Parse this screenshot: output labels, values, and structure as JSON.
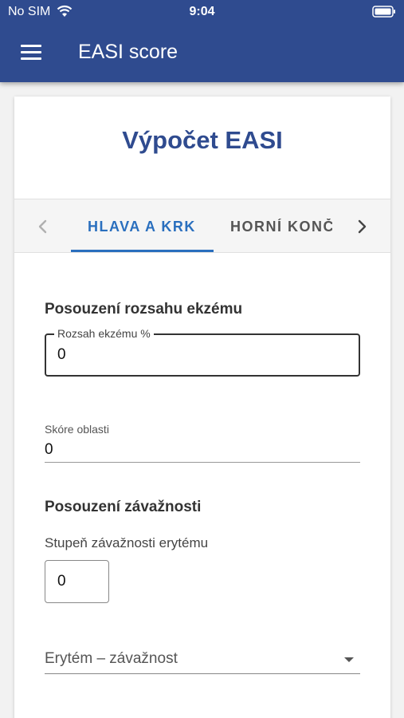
{
  "status_bar": {
    "carrier": "No SIM",
    "time": "9:04"
  },
  "app_bar": {
    "title": "EASI score"
  },
  "card": {
    "title": "Výpočet EASI"
  },
  "tabs": [
    {
      "label": "HLAVA A KRK",
      "active": true
    },
    {
      "label": "HORNÍ KONČ",
      "active": false
    }
  ],
  "extent": {
    "section_title": "Posouzení rozsahu ekzému",
    "field_label": "Rozsah ekzému %",
    "field_value": "0"
  },
  "area_score": {
    "label": "Skóre oblasti",
    "value": "0"
  },
  "severity": {
    "section_title": "Posouzení závažnosti",
    "erythema_label": "Stupeň závažnosti erytému",
    "erythema_value": "0",
    "select_placeholder": "Erytém – závažnost"
  },
  "colors": {
    "primary": "#2f4b8f",
    "accent": "#2a6fbe"
  }
}
